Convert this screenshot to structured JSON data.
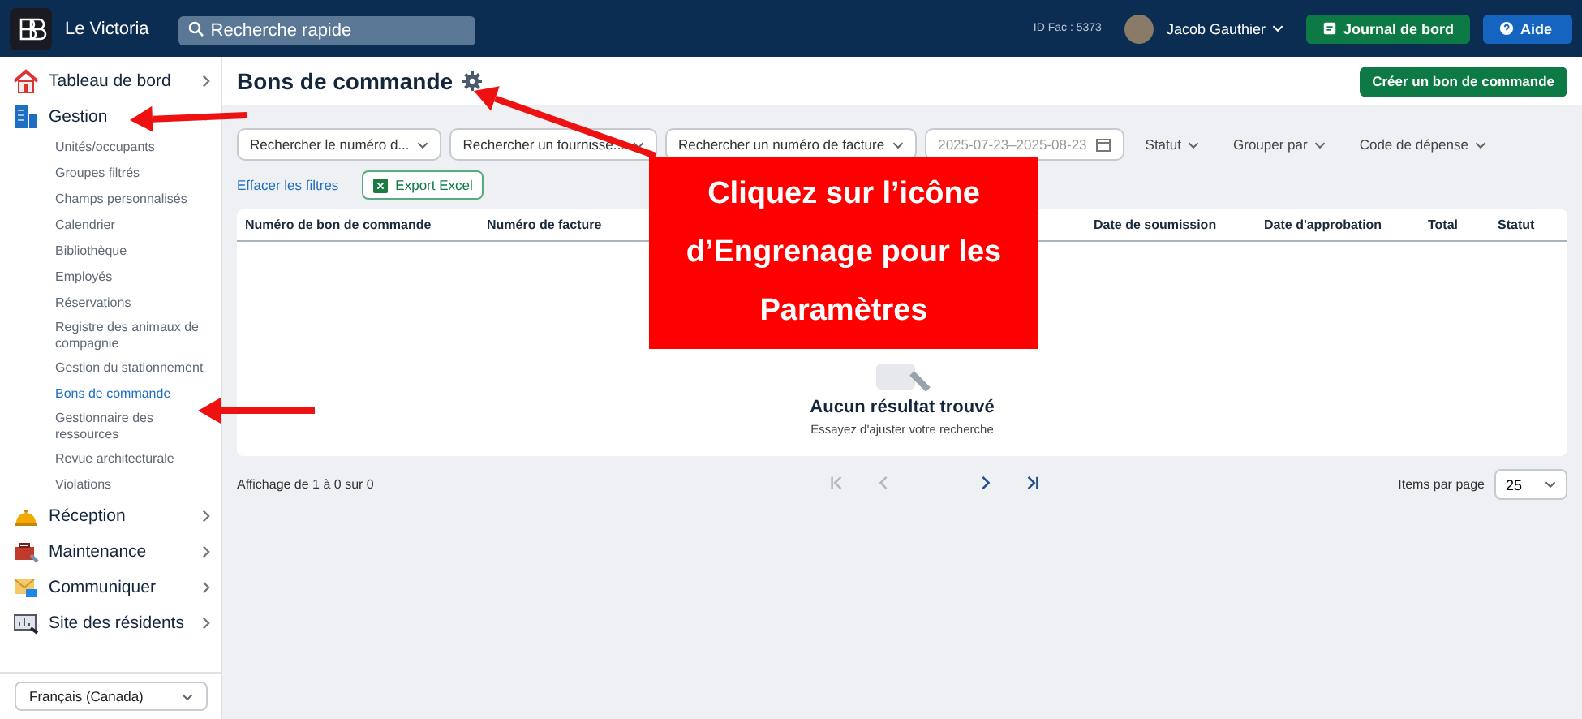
{
  "topbar": {
    "brand": "Le Victoria",
    "search": {
      "placeholder": "Recherche rapide"
    },
    "fac_id": "ID Fac : 5373",
    "user": "Jacob Gauthier",
    "buttons": [
      {
        "label": "Journal de bord",
        "kind": "journal"
      },
      {
        "label": "Aide",
        "kind": "help"
      }
    ]
  },
  "sidebar": {
    "items": [
      {
        "label": "Tableau de bord",
        "kind": "home",
        "expanded": false
      },
      {
        "label": "Gestion",
        "kind": "building",
        "expanded": true,
        "children": [
          {
            "label": "Unités/occupants",
            "selected": false
          },
          {
            "label": "Groupes filtrés",
            "selected": false
          },
          {
            "label": "Champs personnalisés",
            "selected": false
          },
          {
            "label": "Calendrier",
            "selected": false
          },
          {
            "label": "Bibliothèque",
            "selected": false
          },
          {
            "label": "Employés",
            "selected": false
          },
          {
            "label": "Réservations",
            "selected": false
          },
          {
            "label": "Registre des animaux de compagnie",
            "selected": false
          },
          {
            "label": "Gestion du stationnement",
            "selected": false
          },
          {
            "label": "Bons de commande",
            "selected": true
          },
          {
            "label": "Gestionnaire des ressources",
            "selected": false
          },
          {
            "label": "Revue architecturale",
            "selected": false
          },
          {
            "label": "Violations",
            "selected": false
          }
        ]
      },
      {
        "label": "Réception",
        "kind": "bell",
        "expanded": false
      },
      {
        "label": "Maintenance",
        "kind": "toolbox",
        "expanded": false
      },
      {
        "label": "Communiquer",
        "kind": "mail",
        "expanded": false
      },
      {
        "label": "Site des résidents",
        "kind": "screen",
        "expanded": false
      }
    ],
    "language": "Français (Canada)"
  },
  "page": {
    "title": "Bons de commande",
    "create_button": "Créer un bon de commande"
  },
  "filters": [
    {
      "label": "Rechercher le numéro d...",
      "kind": "select"
    },
    {
      "label": "Rechercher un fournisse...",
      "kind": "select"
    },
    {
      "label": "Rechercher un numéro de facture",
      "kind": "select"
    },
    {
      "label": "2025-07-23–2025-08-23",
      "kind": "date"
    },
    {
      "label": "Statut",
      "kind": "menu"
    },
    {
      "label": "Grouper par",
      "kind": "menu"
    },
    {
      "label": "Code de dépense",
      "kind": "menu"
    }
  ],
  "clear_filters": "Effacer les filtres",
  "export_button": "Export Excel",
  "table": {
    "columns": [
      "Numéro de bon de commande",
      "Numéro de facture",
      "Date de soumission",
      "Date d'approbation",
      "Total",
      "Statut"
    ],
    "empty_title": "Aucun résultat trouvé",
    "empty_hint": "Essayez d'ajuster votre recherche"
  },
  "pagination": {
    "summary": "Affichage de 1 à 0 sur 0",
    "per_page_label": "Items par page",
    "per_page": "25"
  },
  "callout": {
    "text": "Cliquez sur l’icône d’Engrenage pour les Paramètres"
  }
}
